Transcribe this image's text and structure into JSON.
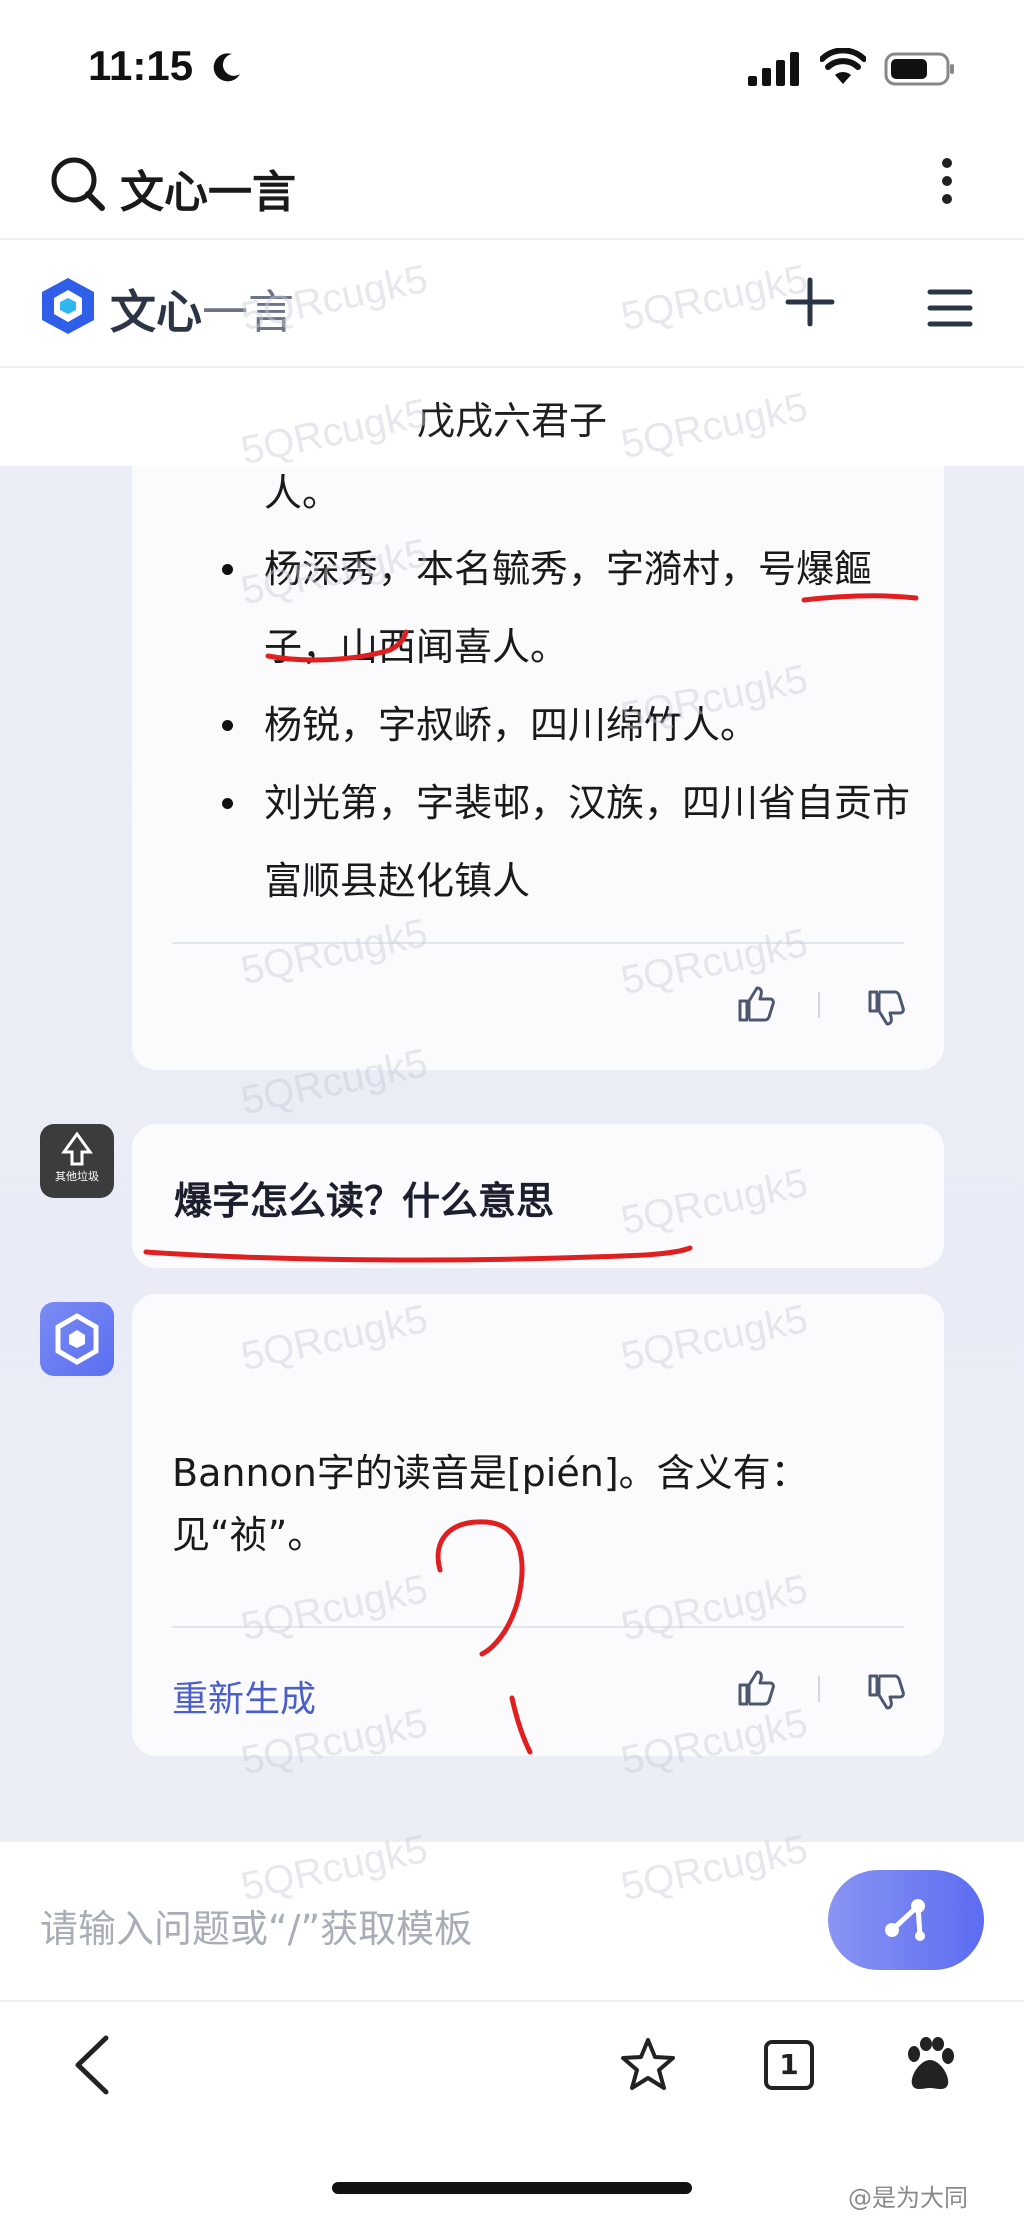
{
  "status_bar": {
    "time": "11:15"
  },
  "browser_bar": {
    "title": "文心一言"
  },
  "app_header": {
    "name_primary": "文心",
    "name_light": "一言"
  },
  "conversation": {
    "title": "戊戌六君子"
  },
  "previous_answer": {
    "fragment": "人。",
    "bullets": [
      "杨深秀，本名毓秀，字漪村，号爆饇子，山西闻喜人。",
      "杨锐，字叔峤，四川绵竹人。",
      "刘光第，字裴邨，汉族，四川省自贡市富顺县赵化镇人"
    ]
  },
  "user_message": {
    "avatar_text": "其他垃圾",
    "text": "爆字怎么读？什么意思"
  },
  "bot_message": {
    "text": "Bannon字的读音是[pién]。含义有：见“祯”。",
    "regenerate_label": "重新生成"
  },
  "input": {
    "placeholder": "请输入问题或“/”获取模板"
  },
  "bottom_nav": {
    "tab_count": "1"
  },
  "watermark_text": "5QRcugk5",
  "credit": "@是为大同",
  "colors": {
    "accent": "#4b5fc8",
    "send_gradient_start": "#8a95f3",
    "send_gradient_end": "#5c6cf2",
    "annotation_red": "#e02020"
  }
}
